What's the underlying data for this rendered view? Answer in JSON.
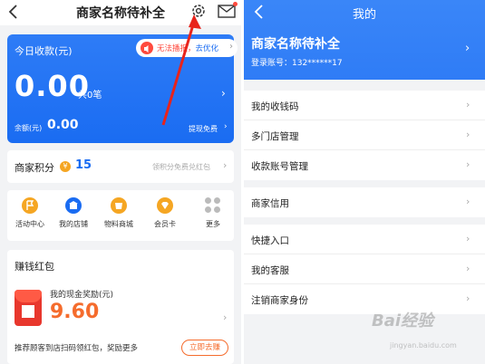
{
  "left": {
    "nav_title": "商家名称待补全",
    "income": {
      "label": "今日收款(元)",
      "warning_text": "无法播报，",
      "warning_link": "去优化",
      "amount": "0.00",
      "count": "共0笔",
      "balance_label": "余额(元)",
      "balance": "0.00",
      "withdraw": "提现免费"
    },
    "points": {
      "label": "商家积分",
      "value": "15",
      "hint": "领积分免费兑红包"
    },
    "shortcuts": [
      {
        "label": "活动中心",
        "icon": "flag-icon",
        "color": "#f5a623"
      },
      {
        "label": "我的店铺",
        "icon": "store-icon",
        "color": "#1a6cf2"
      },
      {
        "label": "物料商城",
        "icon": "shop-icon",
        "color": "#f5a623"
      },
      {
        "label": "会员卡",
        "icon": "member-card-icon",
        "color": "#f5a623"
      },
      {
        "label": "更多",
        "icon": "more-icon",
        "color": "#bbbbbb"
      }
    ],
    "red_packet": {
      "header": "赚钱红包",
      "subtitle": "我的现金奖励(元)",
      "value": "9.60",
      "footer": "推荐顾客到店扫码领红包，奖励更多",
      "button": "立即去赚"
    }
  },
  "right": {
    "nav_title": "我的",
    "merchant_name": "商家名称待补全",
    "account": "登录账号：132******17",
    "groups": [
      [
        "我的收钱码",
        "多门店管理",
        "收款账号管理"
      ],
      [
        "商家信用"
      ],
      [
        "快捷入口",
        "我的客服",
        "注销商家身份"
      ]
    ]
  },
  "watermark": {
    "text": "Bai经验",
    "sub": "jingyan.baidu.com"
  },
  "colors": {
    "brand_blue": "#1a6cf2",
    "accent_orange": "#f56c2d",
    "alert_red": "#ff4a3d"
  }
}
